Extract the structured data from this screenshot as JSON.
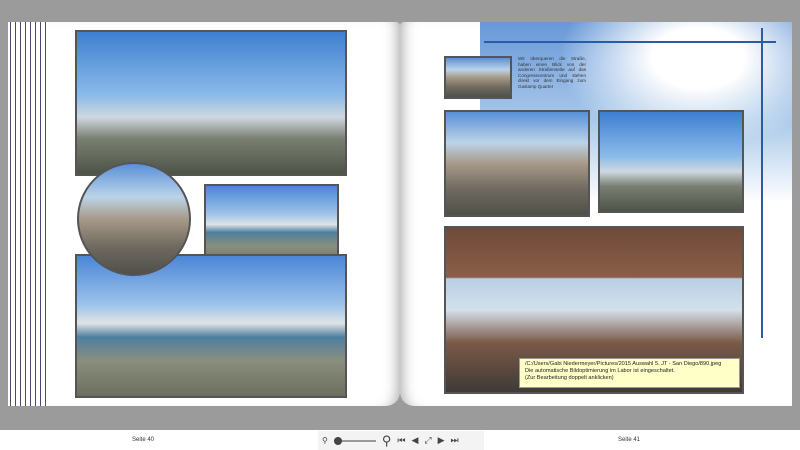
{
  "left_page": {
    "label": "Seite 40"
  },
  "right_page": {
    "label": "Seite 41",
    "caption": "Wir überqueren die Straße, haben einen Blick von der anderen Straßenseite auf das Congresscentrum und stehen direkt vor dem Eingang zum Gaslamp Quarter"
  },
  "tooltip": {
    "line1": "/C:/Users/Gabi Niedermeyer/Pictures/2015 Auswahl 5. JT - San Diego/890.jpeg",
    "line2": "Die automatische Bildoptimierung im Labor ist eingeschaltet.",
    "line3": "(Zur Bearbeitung doppelt anklicken)"
  },
  "toolbar": {
    "zoom_level": 0.1,
    "icons": [
      "zoom-out-icon",
      "zoom-slider",
      "zoom-in-icon",
      "first-page-icon",
      "prev-page-icon",
      "fit-icon",
      "next-page-icon",
      "last-page-icon"
    ]
  },
  "colors": {
    "accent_line": "#2a5aa8",
    "tooltip_bg": "#ffffc8"
  }
}
